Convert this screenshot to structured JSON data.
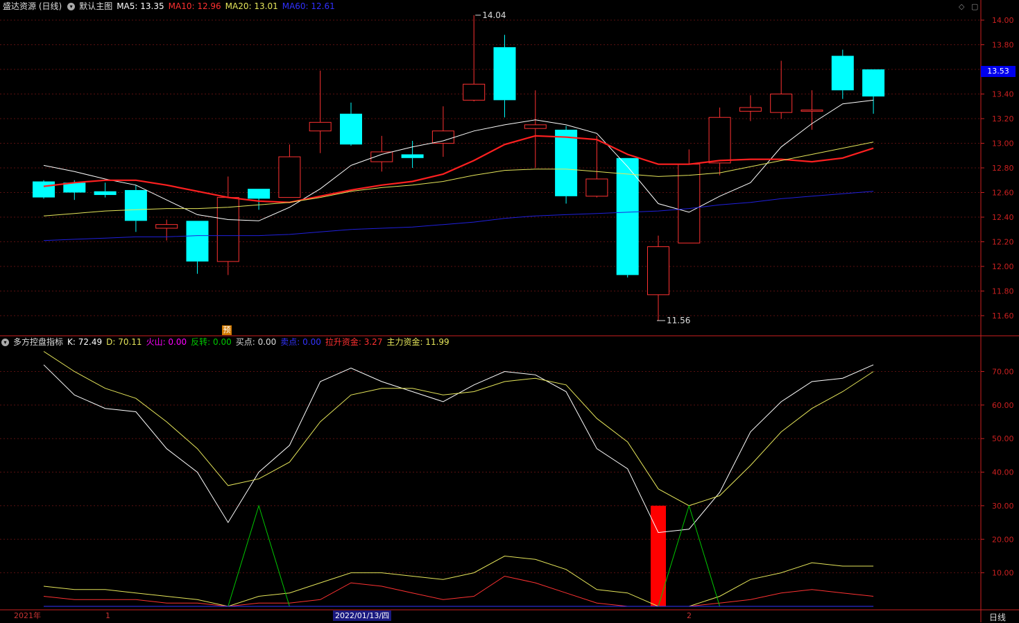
{
  "main_header": {
    "stock_name": "盛达资源 (日线)",
    "template": "默认主图",
    "ma5": "MA5: 13.35",
    "ma10": "MA10: 12.96",
    "ma20": "MA20: 13.01",
    "ma60": "MA60: 12.61"
  },
  "indicator_header": {
    "name": "多方控盘指标",
    "k": "K: 72.49",
    "d": "D: 70.11",
    "huoshan": "火山: 0.00",
    "fanzhuan": "反转: 0.00",
    "maidian": "买点: 0.00",
    "maichu": "卖点: 0.00",
    "lasheng": "拉升资金: 3.27",
    "zhuli": "主力资金: 11.99"
  },
  "current_price": "13.53",
  "yu_badge": "预",
  "timeframe": "日线",
  "x_axis": {
    "year_label": "2021年",
    "month1": "1",
    "month2": "2",
    "cursor_date": "2022/01/13/四"
  },
  "colors": {
    "up": "#ff3232",
    "down": "#00ffff",
    "ma5": "#ffffff",
    "ma10": "#ff2020",
    "ma20": "#e6e65a",
    "ma60": "#2020dd",
    "axis": "#cc2020",
    "k": "#ffffff",
    "d": "#e6e65a",
    "green": "#00c800",
    "magenta": "#ff00ff",
    "blue": "#3333ff"
  },
  "chart_data": [
    {
      "type": "candlestick",
      "title": "盛达资源 (日线)",
      "ylim": [
        11.45,
        14.12
      ],
      "yticks": [
        14.0,
        13.8,
        13.6,
        13.4,
        13.2,
        13.0,
        12.8,
        12.6,
        12.4,
        12.2,
        12.0,
        11.8,
        11.6
      ],
      "annotations": [
        "14.04",
        "11.56"
      ],
      "candles": [
        {
          "o": 12.69,
          "h": 12.7,
          "l": 12.55,
          "c": 12.56
        },
        {
          "o": 12.68,
          "h": 12.7,
          "l": 12.54,
          "c": 12.6
        },
        {
          "o": 12.61,
          "h": 12.68,
          "l": 12.56,
          "c": 12.58
        },
        {
          "o": 12.62,
          "h": 12.66,
          "l": 12.28,
          "c": 12.37
        },
        {
          "o": 12.31,
          "h": 12.38,
          "l": 12.21,
          "c": 12.34
        },
        {
          "o": 12.37,
          "h": 12.37,
          "l": 11.94,
          "c": 12.04
        },
        {
          "o": 12.04,
          "h": 12.73,
          "l": 11.93,
          "c": 12.56
        },
        {
          "o": 12.63,
          "h": 12.63,
          "l": 12.46,
          "c": 12.55
        },
        {
          "o": 12.56,
          "h": 12.99,
          "l": 12.56,
          "c": 12.89
        },
        {
          "o": 13.1,
          "h": 13.59,
          "l": 12.92,
          "c": 13.17
        },
        {
          "o": 13.24,
          "h": 13.33,
          "l": 12.98,
          "c": 12.99
        },
        {
          "o": 12.85,
          "h": 13.06,
          "l": 12.77,
          "c": 12.93
        },
        {
          "o": 12.91,
          "h": 13.02,
          "l": 12.8,
          "c": 12.88
        },
        {
          "o": 13.0,
          "h": 13.3,
          "l": 12.89,
          "c": 13.1
        },
        {
          "o": 13.35,
          "h": 14.04,
          "l": 13.34,
          "c": 13.48
        },
        {
          "o": 13.78,
          "h": 13.88,
          "l": 13.21,
          "c": 13.35
        },
        {
          "o": 13.12,
          "h": 13.43,
          "l": 12.8,
          "c": 13.15
        },
        {
          "o": 13.11,
          "h": 13.14,
          "l": 12.51,
          "c": 12.57
        },
        {
          "o": 12.57,
          "h": 13.06,
          "l": 12.56,
          "c": 12.71
        },
        {
          "o": 12.88,
          "h": 12.88,
          "l": 11.91,
          "c": 11.93
        },
        {
          "o": 11.77,
          "h": 12.25,
          "l": 11.56,
          "c": 12.16
        },
        {
          "o": 12.19,
          "h": 12.95,
          "l": 12.19,
          "c": 12.83
        },
        {
          "o": 12.84,
          "h": 13.29,
          "l": 12.74,
          "c": 13.21
        },
        {
          "o": 13.26,
          "h": 13.39,
          "l": 13.18,
          "c": 13.29
        },
        {
          "o": 13.25,
          "h": 13.67,
          "l": 13.2,
          "c": 13.4
        },
        {
          "o": 13.26,
          "h": 13.43,
          "l": 13.11,
          "c": 13.27
        },
        {
          "o": 13.71,
          "h": 13.76,
          "l": 13.36,
          "c": 13.43
        },
        {
          "o": 13.6,
          "h": 13.59,
          "l": 13.24,
          "c": 13.38
        }
      ],
      "series": [
        {
          "name": "MA5",
          "values": [
            12.82,
            12.77,
            12.71,
            12.66,
            12.54,
            12.42,
            12.38,
            12.37,
            12.48,
            12.63,
            12.82,
            12.91,
            12.97,
            13.02,
            13.1,
            13.15,
            13.19,
            13.15,
            13.08,
            12.81,
            12.51,
            12.44,
            12.57,
            12.68,
            12.97,
            13.16,
            13.32,
            13.35
          ]
        },
        {
          "name": "MA10",
          "values": [
            12.65,
            12.68,
            12.7,
            12.7,
            12.66,
            12.61,
            12.56,
            12.53,
            12.52,
            12.57,
            12.62,
            12.66,
            12.69,
            12.75,
            12.86,
            12.99,
            13.06,
            13.05,
            13.03,
            12.91,
            12.83,
            12.83,
            12.86,
            12.87,
            12.87,
            12.85,
            12.88,
            12.96
          ]
        },
        {
          "name": "MA20",
          "values": [
            12.41,
            12.43,
            12.45,
            12.46,
            12.47,
            12.47,
            12.48,
            12.5,
            12.52,
            12.56,
            12.61,
            12.64,
            12.66,
            12.69,
            12.74,
            12.78,
            12.79,
            12.79,
            12.77,
            12.75,
            12.73,
            12.74,
            12.76,
            12.81,
            12.86,
            12.91,
            12.96,
            13.01
          ]
        },
        {
          "name": "MA60",
          "values": [
            12.21,
            12.22,
            12.23,
            12.24,
            12.24,
            12.25,
            12.25,
            12.25,
            12.26,
            12.28,
            12.3,
            12.31,
            12.32,
            12.34,
            12.36,
            12.39,
            12.41,
            12.42,
            12.43,
            12.44,
            12.45,
            12.47,
            12.5,
            12.52,
            12.55,
            12.57,
            12.59,
            12.61
          ]
        }
      ]
    },
    {
      "type": "line",
      "title": "多方控盘指标",
      "ylim": [
        0,
        79
      ],
      "yticks": [
        70,
        60,
        50,
        40,
        30,
        20,
        10
      ],
      "series": [
        {
          "name": "K",
          "values": [
            72,
            63,
            59,
            58,
            47,
            40,
            25,
            40,
            48,
            67,
            71,
            67,
            64,
            61,
            66,
            70,
            69,
            64,
            47,
            41,
            22,
            23,
            34,
            52,
            61,
            67,
            68,
            72
          ]
        },
        {
          "name": "D",
          "values": [
            76,
            70,
            65,
            62,
            55,
            47,
            36,
            38,
            43,
            55,
            63,
            65,
            65,
            63,
            64,
            67,
            68,
            66,
            56,
            49,
            35,
            30,
            33,
            42,
            52,
            59,
            64,
            70
          ]
        },
        {
          "name": "主力资金",
          "values": [
            6,
            5,
            5,
            4,
            3,
            2,
            0,
            3,
            4,
            7,
            10,
            10,
            9,
            8,
            10,
            15,
            14,
            11,
            5,
            4,
            0,
            0,
            3,
            8,
            10,
            13,
            12,
            12
          ]
        },
        {
          "name": "拉升资金",
          "values": [
            3,
            2,
            2,
            2,
            1,
            1,
            0,
            1,
            1,
            2,
            7,
            6,
            4,
            2,
            3,
            9,
            7,
            4,
            1,
            0,
            0,
            0,
            1,
            2,
            4,
            5,
            4,
            3
          ]
        },
        {
          "name": "反转",
          "values": [
            0,
            0,
            0,
            0,
            0,
            0,
            0,
            30,
            0,
            0,
            0,
            0,
            0,
            0,
            0,
            0,
            0,
            0,
            0,
            0,
            0,
            30,
            0,
            0,
            0,
            0,
            0,
            0
          ]
        },
        {
          "name": "卖点",
          "values": [
            0,
            0,
            0,
            0,
            0,
            0,
            0,
            0,
            0,
            0,
            0,
            0,
            0,
            0,
            0,
            0,
            0,
            0,
            0,
            0,
            0,
            0,
            0,
            0,
            0,
            0,
            0,
            0
          ]
        }
      ],
      "bars": [
        {
          "index": 20,
          "value": 30
        }
      ]
    }
  ]
}
